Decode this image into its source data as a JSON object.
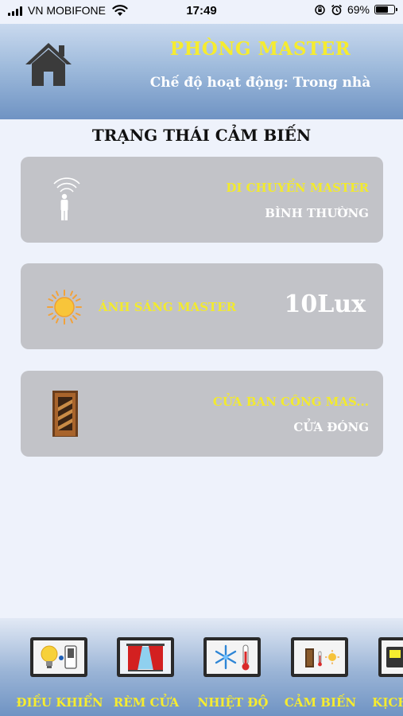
{
  "status_bar": {
    "carrier": "VN MOBIFONE",
    "time": "17:49",
    "battery": "69%",
    "battery_level": 0.69
  },
  "header": {
    "title": "PHÒNG MASTER",
    "mode": "Chế độ hoạt động: Trong nhà"
  },
  "section_title": "TRẠNG THÁI CẢM BIẾN",
  "cards": [
    {
      "label": "DI CHUYỂN MASTER",
      "value": "BÌNH THƯỜNG",
      "icon": "motion-sensor-icon"
    },
    {
      "label": "ÁNH SÁNG MASTER",
      "value": "10Lux",
      "icon": "sun-icon"
    },
    {
      "label": "CỬA BAN CÔNG MAS...",
      "value": "CỬA ĐÓNG",
      "icon": "door-icon"
    }
  ],
  "nav": [
    {
      "label": "ĐIỀU KHIỂN",
      "icon": "control-icon"
    },
    {
      "label": "RÈM CỬA",
      "icon": "curtain-icon"
    },
    {
      "label": "NHIỆT ĐỘ",
      "icon": "temperature-icon"
    },
    {
      "label": "CẢM BIẾN",
      "icon": "sensor-icon"
    },
    {
      "label": "KỊCH BẢN",
      "icon": "scenario-icon"
    }
  ],
  "colors": {
    "accent_yellow": "#f6ec2f",
    "card_bg": "#c2c3c8",
    "header_blue": "#6f93c3",
    "page_bg": "#eef2fb"
  }
}
